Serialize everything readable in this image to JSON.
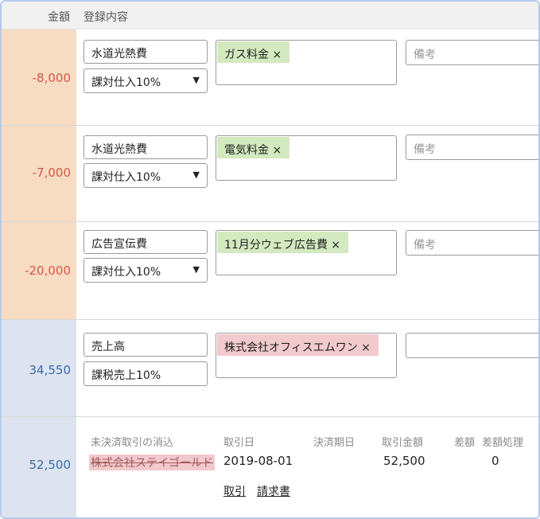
{
  "header": {
    "amount_label": "金額",
    "content_label": "登録内容"
  },
  "rows": [
    {
      "amount": "-8,000",
      "account": "水道光熱費",
      "tax": "課対仕入10%",
      "tag": "ガス料金 ×",
      "memo_placeholder": "備考"
    },
    {
      "amount": "-7,000",
      "account": "水道光熱費",
      "tax": "課対仕入10%",
      "tag": "電気料金 ×",
      "memo_placeholder": "備考"
    },
    {
      "amount": "-20,000",
      "account": "広告宣伝費",
      "tax": "課対仕入10%",
      "tag": "11月分ウェブ広告費 ×",
      "memo_placeholder": "備考"
    },
    {
      "amount": "34,550",
      "account": "売上高",
      "tax": "課税売上10%",
      "tag": "株式会社オフィスエムワン ×",
      "memo_placeholder": ""
    }
  ],
  "settlement": {
    "amount": "52,500",
    "headers": {
      "title": "未決済取引の消込",
      "date": "取引日",
      "due": "決済期日",
      "trade_amount": "取引金額",
      "diff": "差額",
      "diff_process": "差額処理"
    },
    "partner": "株式会社ステイゴールド",
    "date": "2019-08-01",
    "trade_amount": "52,500",
    "diff": "0",
    "links": {
      "trade": "取引",
      "invoice": "請求書"
    }
  },
  "colors": {
    "expense_bg": "#f7dcc2",
    "expense_text": "#d9544a",
    "income_bg": "#dde4f0",
    "income_text": "#3c6aa8",
    "tag_green": "#d3e9bf",
    "tag_red": "#f2c9cd"
  },
  "icons": {
    "dropdown": "triangle-down-icon",
    "remove_tag": "close-icon"
  }
}
